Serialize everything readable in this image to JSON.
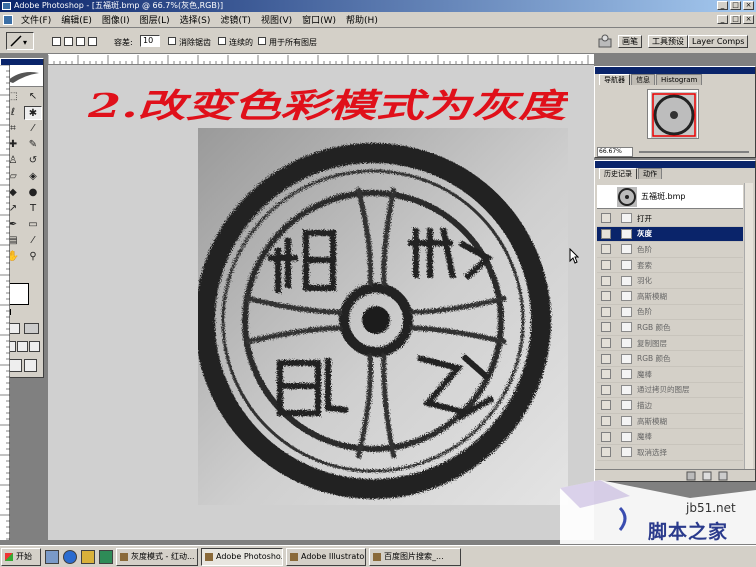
{
  "window": {
    "title": "Adobe Photoshop - [五福斑.bmp @ 66.7%(灰色,RGB)]"
  },
  "menubar": [
    "文件(F)",
    "编辑(E)",
    "图像(I)",
    "图层(L)",
    "选择(S)",
    "滤镜(T)",
    "视图(V)",
    "窗口(W)",
    "帮助(H)"
  ],
  "options_bar": {
    "tolerance_label": "容差:",
    "tolerance_value": "10",
    "anti_alias_label": "消除锯齿",
    "contiguous_label": "连续的",
    "all_layers_label": "用于所有图层",
    "palette_tabs": [
      "画笔",
      "工具预设",
      "Layer Comps"
    ]
  },
  "annotation": {
    "text": "2.改变色彩模式为灰度",
    "color": "#e0101a"
  },
  "navigator": {
    "tabs": [
      "导航器",
      "信息",
      "Histogram"
    ],
    "zoom": "66.67%"
  },
  "history": {
    "tabs": [
      "历史记录",
      "动作"
    ],
    "snapshot_label": "五福斑.bmp",
    "steps": [
      {
        "label": "打开",
        "state": "normal"
      },
      {
        "label": "灰度",
        "state": "selected"
      },
      {
        "label": "色阶",
        "state": "dimmed"
      },
      {
        "label": "套索",
        "state": "dimmed"
      },
      {
        "label": "羽化",
        "state": "dimmed"
      },
      {
        "label": "高斯模糊",
        "state": "dimmed"
      },
      {
        "label": "色阶",
        "state": "dimmed"
      },
      {
        "label": "RGB 颜色",
        "state": "dimmed"
      },
      {
        "label": "复制图层",
        "state": "dimmed"
      },
      {
        "label": "RGB 颜色",
        "state": "dimmed"
      },
      {
        "label": "魔棒",
        "state": "dimmed"
      },
      {
        "label": "通过拷贝的图层",
        "state": "dimmed"
      },
      {
        "label": "描边",
        "state": "dimmed"
      },
      {
        "label": "高斯模糊",
        "state": "dimmed"
      },
      {
        "label": "魔棒",
        "state": "dimmed"
      },
      {
        "label": "取消选择",
        "state": "dimmed"
      }
    ]
  },
  "watermark": {
    "site": "jb51.net",
    "name": "脚本之家"
  },
  "taskbar": {
    "start_label": "开始",
    "tasks": [
      {
        "label": "灰度模式 - 红动...",
        "active": false
      },
      {
        "label": "Adobe Photosho...",
        "active": true
      },
      {
        "label": "Adobe Illustrator",
        "active": false
      },
      {
        "label": "百度图片搜索_...",
        "active": false
      }
    ]
  },
  "colors": {
    "accent": "#0a246a",
    "panel": "#d4d0c8"
  }
}
